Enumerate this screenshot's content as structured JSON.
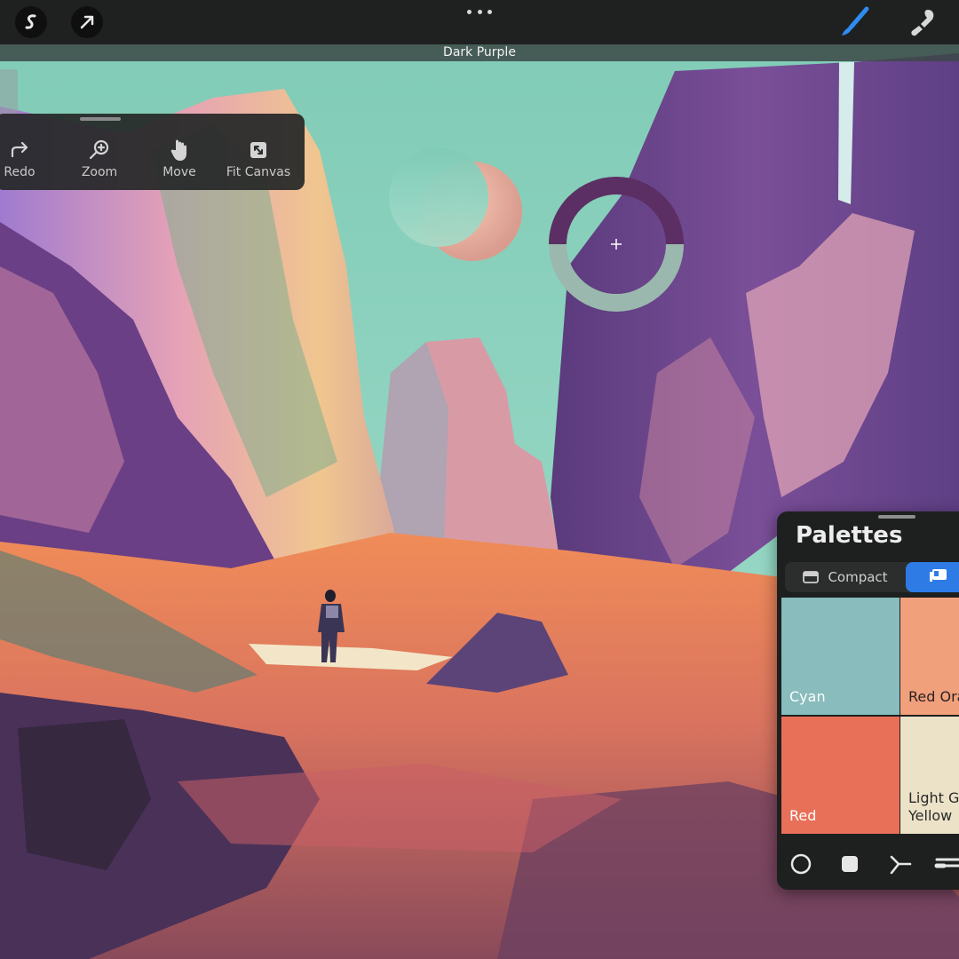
{
  "app": {
    "current_color_name": "Dark Purple"
  },
  "colors": {
    "current": "#5b2f63",
    "previous": "#9ab8ae",
    "sky": "#8fd3c0",
    "panel_bg": "#1e1f1f",
    "accent": "#2e7be6"
  },
  "topbar": {
    "left_icons": [
      "actions-icon",
      "transform-arrow-icon"
    ],
    "center_icon": "more-dots-icon",
    "right_icons": [
      "brush-icon",
      "smudge-icon"
    ]
  },
  "quick_menu": {
    "items": [
      {
        "label": "Redo",
        "icon": "redo-icon"
      },
      {
        "label": "Zoom",
        "icon": "zoom-icon"
      },
      {
        "label": "Move",
        "icon": "hand-icon"
      },
      {
        "label": "Fit Canvas",
        "icon": "fit-canvas-icon"
      }
    ]
  },
  "palettes": {
    "title": "Palettes",
    "tabs": [
      {
        "label": "Compact",
        "icon": "compact-view-icon"
      },
      {
        "label": "",
        "icon": "card-view-icon"
      }
    ],
    "swatches": [
      {
        "name": "Cyan",
        "color": "#88bcbd"
      },
      {
        "name": "Red Ora",
        "color": "#f1a07c"
      },
      {
        "name": "Red",
        "color": "#e87059"
      },
      {
        "name": "Light Gr",
        "name2": "Yellow",
        "color": "#ece2c8"
      }
    ],
    "tools": [
      "disc-mode-icon",
      "square-mode-icon",
      "harmony-icon",
      "value-sliders-icon"
    ]
  }
}
